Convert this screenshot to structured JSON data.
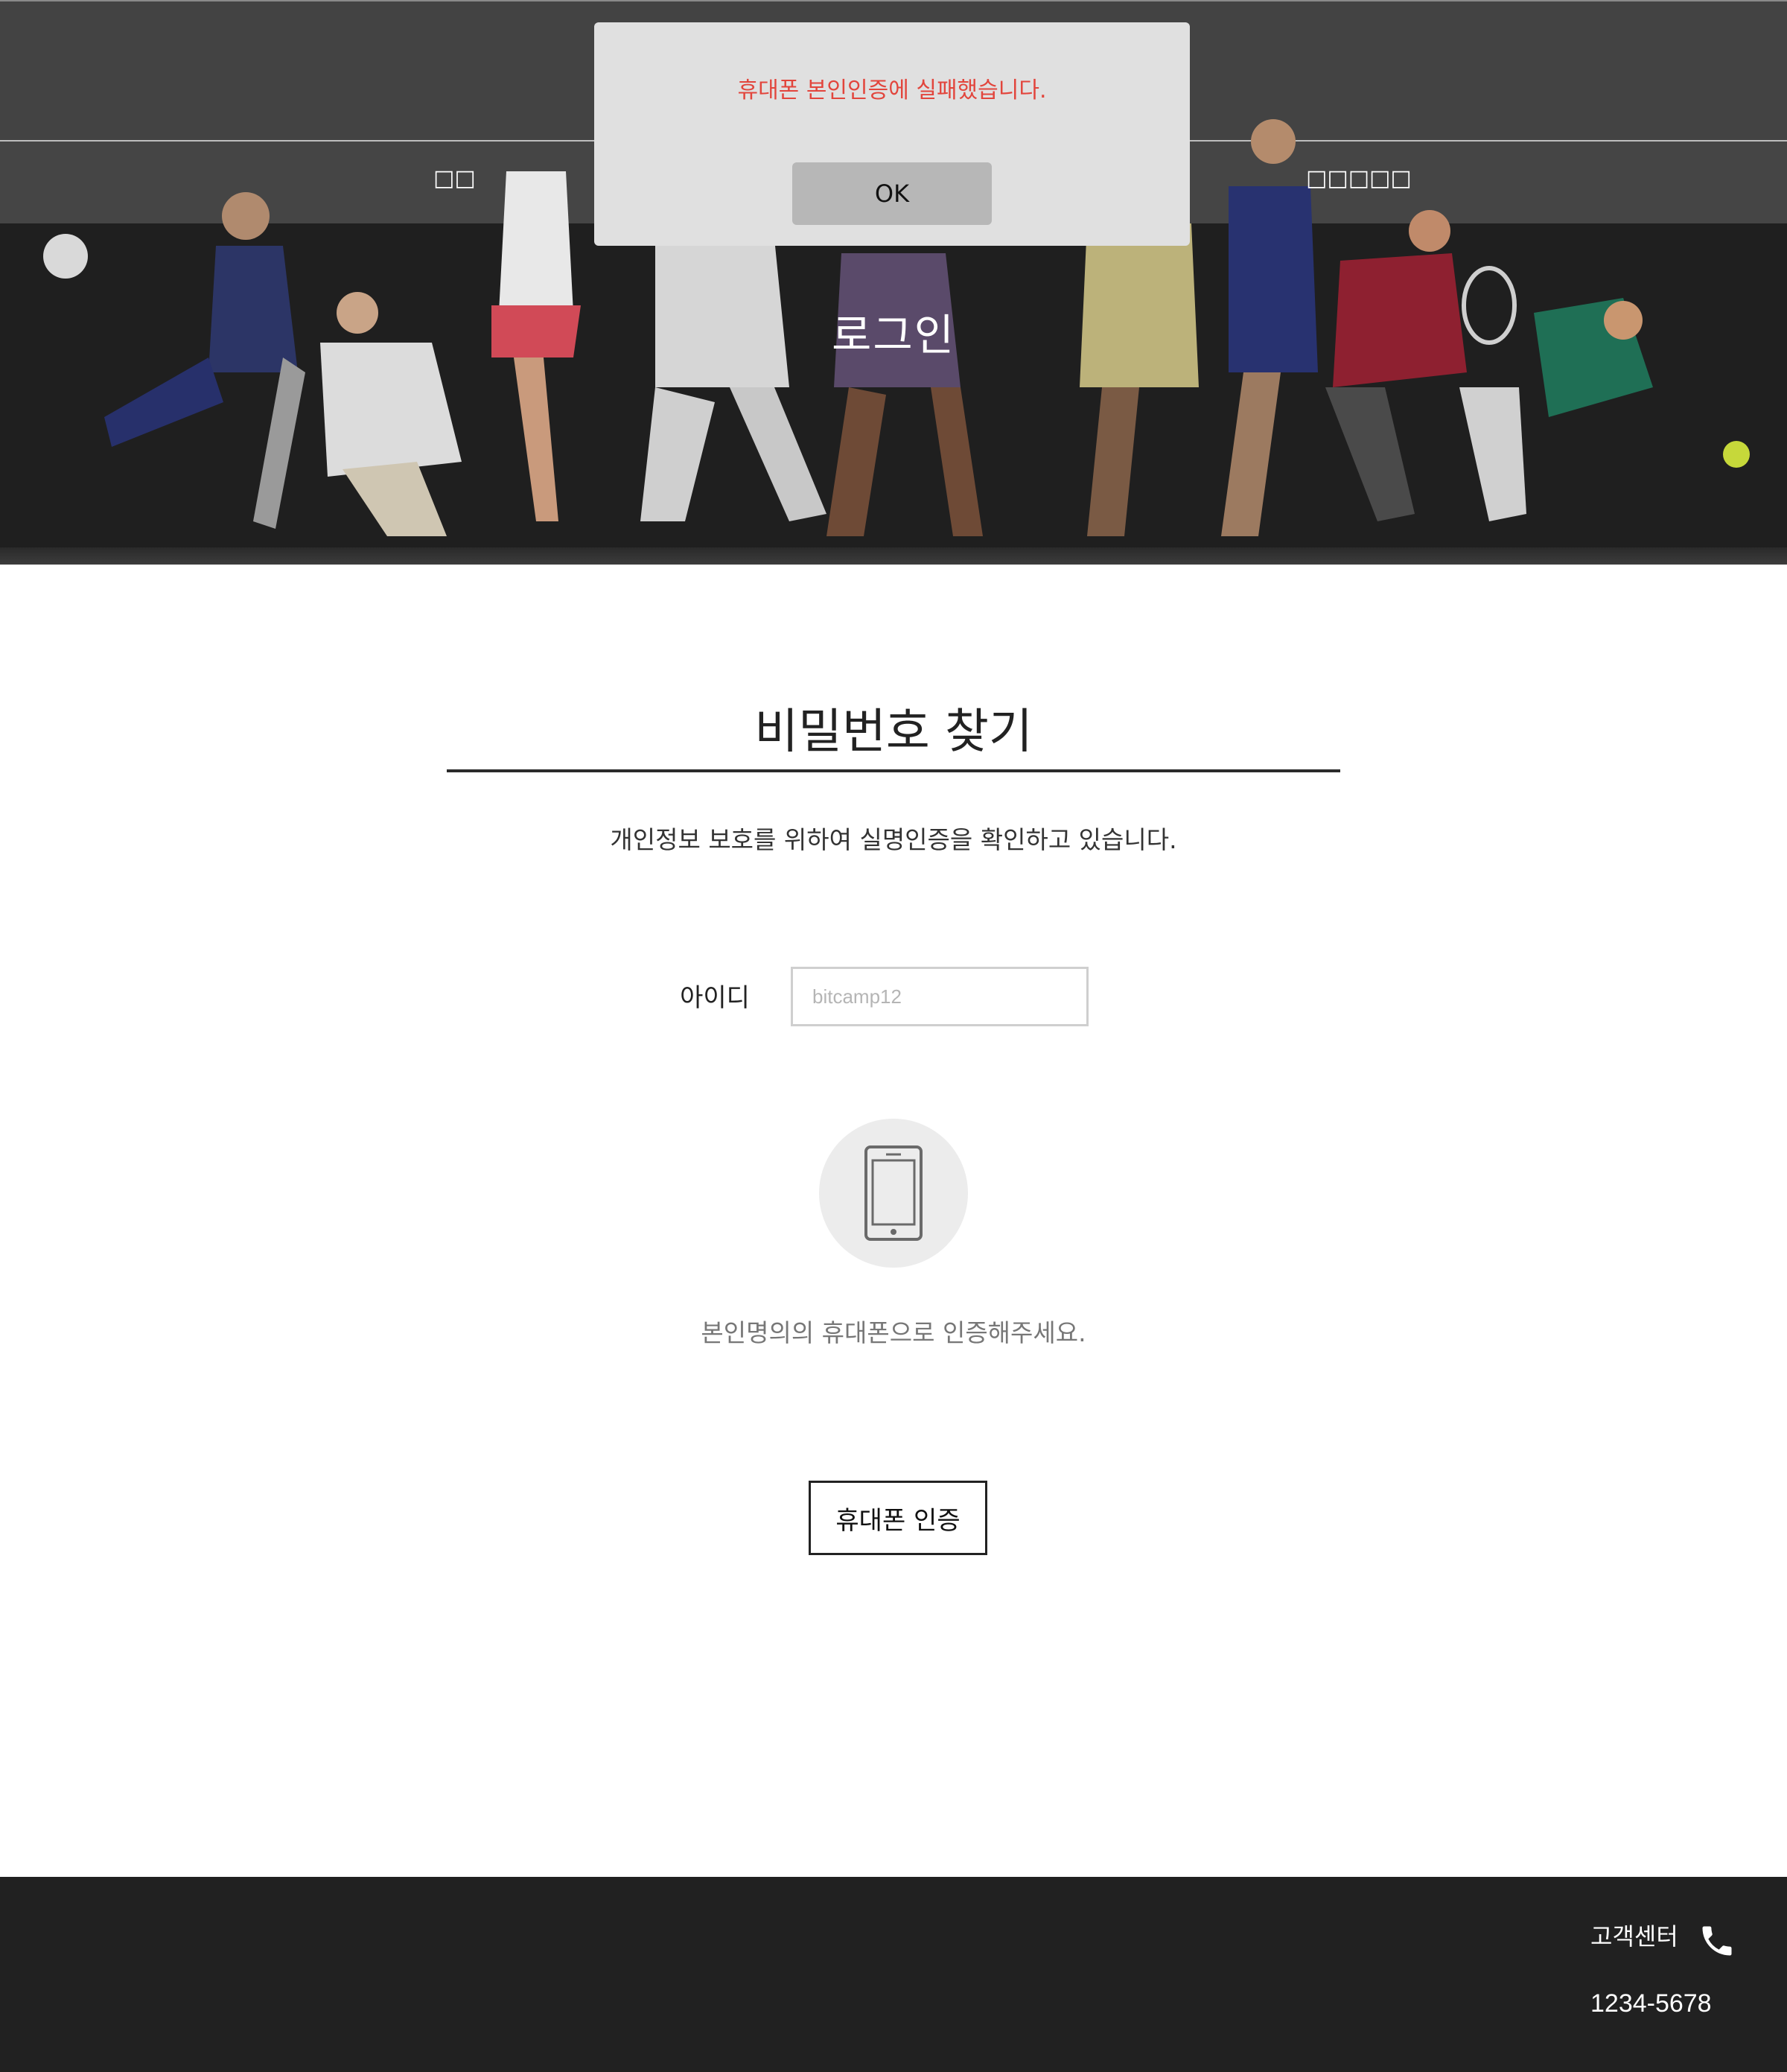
{
  "header": {
    "nav_left": "□□",
    "nav_right": "□□□□□",
    "hero_title": "로그인"
  },
  "alert": {
    "message": "휴대폰 본인인증에 실패했습니다.",
    "ok_label": "OK"
  },
  "main": {
    "title": "비밀번호 찾기",
    "subtitle": "개인정보 보호를 위하여 실명인증을 확인하고 있습니다.",
    "id_label": "아이디",
    "id_placeholder": "bitcamp12",
    "phone_icon": "mobile-phone-icon",
    "help_text": "본인명의의 휴대폰으로 인증해주세요.",
    "verify_button": "휴대폰 인증"
  },
  "footer": {
    "cs_label": "고객센터",
    "cs_icon": "phone-icon",
    "cs_number": "1234-5678"
  },
  "colors": {
    "alert_text": "#e2453c",
    "alert_bg": "#e0e0e0",
    "ok_button_bg": "#b7b7b7",
    "header_band": "#434343",
    "hero_bg": "#1f1f1f",
    "footer_bg": "#212121"
  }
}
